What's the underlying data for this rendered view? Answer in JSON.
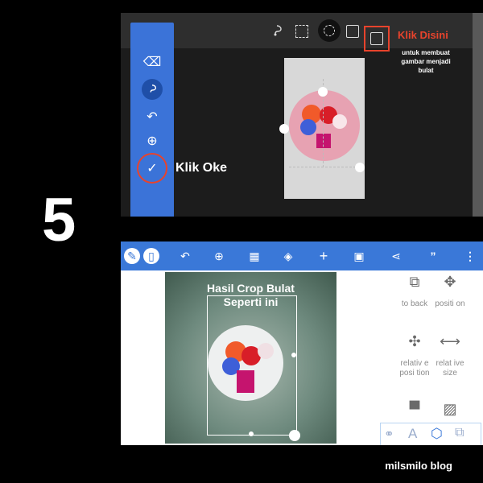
{
  "step_number": "5",
  "top": {
    "annotation_title": "Klik Disini",
    "annotation_desc": "untuk membuat gambar menjadi bulat",
    "ok_label": "Klik Oke",
    "toolbar_icons": [
      "lasso-icon",
      "rect-select-icon",
      "circle-select-icon",
      "mask-icon",
      "image-circle-icon"
    ],
    "side_icons": [
      "eraser-icon",
      "lasso-icon",
      "undo-icon",
      "zoom-icon",
      "check-icon"
    ]
  },
  "bottom": {
    "caption_line1": "Hasil Crop Bulat",
    "caption_line2": "Seperti  ini",
    "tools": [
      {
        "label": "to back"
      },
      {
        "label": "positi on"
      },
      {
        "label": "relativ e posi tion"
      },
      {
        "label": "relat ive size"
      }
    ]
  },
  "watermark": "milsmilo blog",
  "colors": {
    "accent_blue": "#3b73d8",
    "highlight_red": "#e8432c",
    "background": "#000000"
  }
}
